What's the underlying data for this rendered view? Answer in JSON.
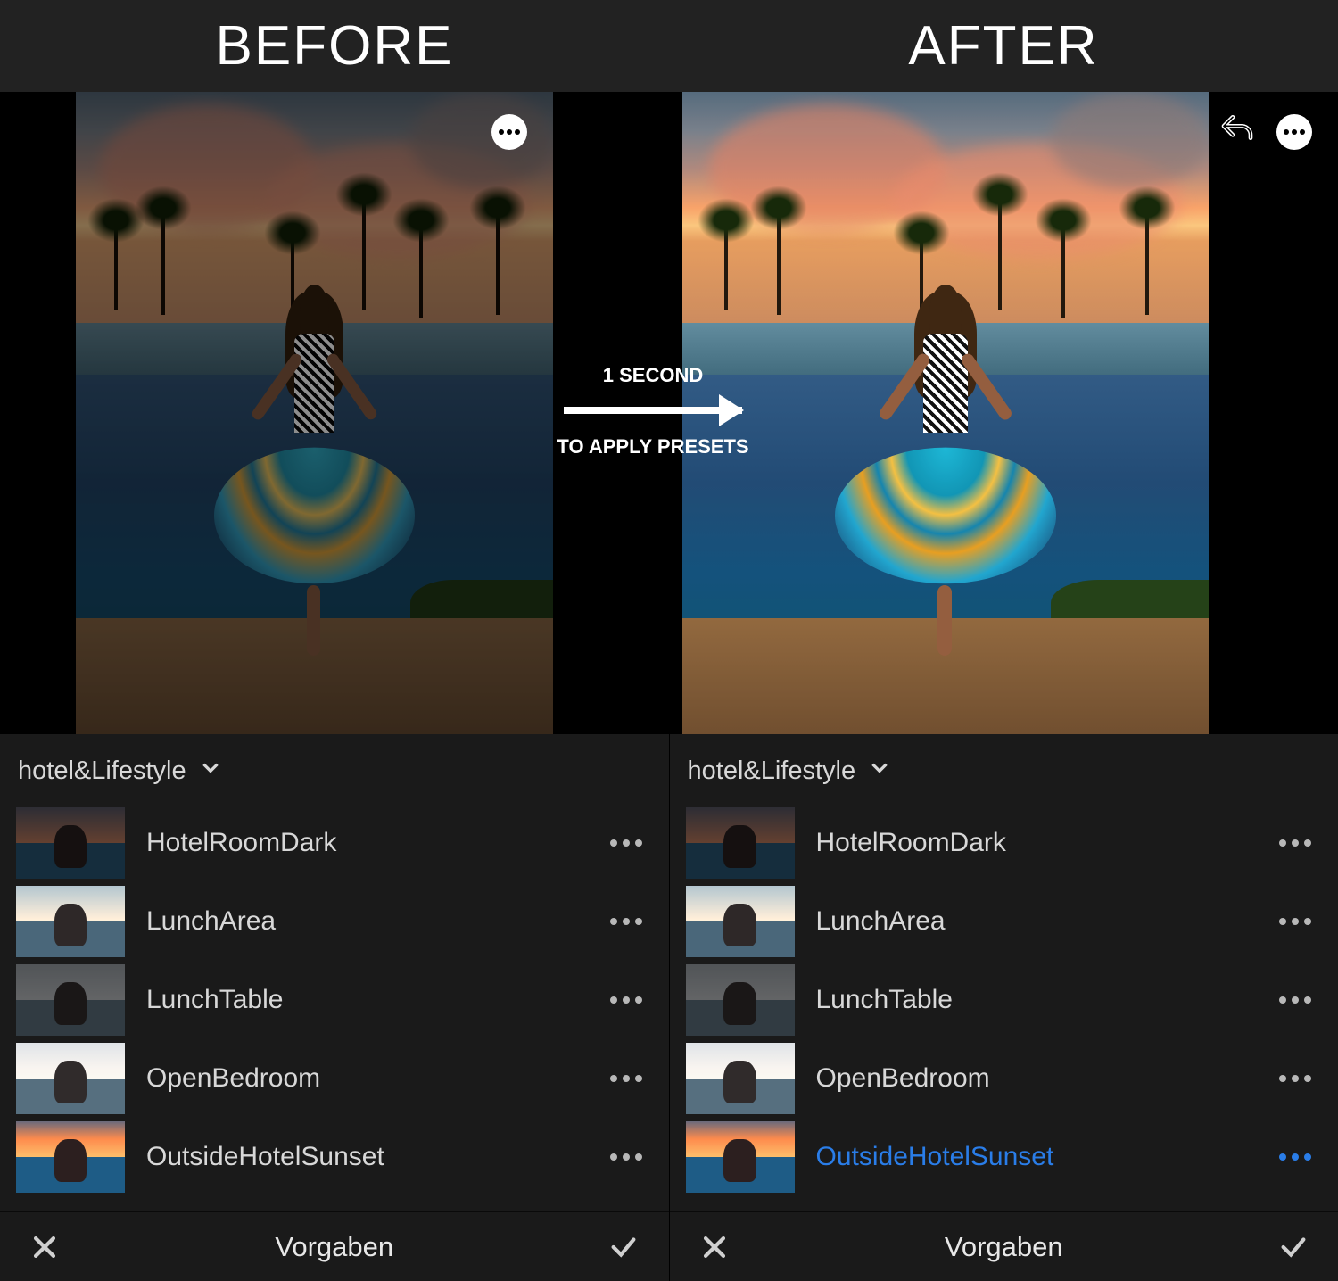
{
  "header": {
    "left": "BEFORE",
    "right": "AFTER"
  },
  "annotation": {
    "line1": "1 SECOND",
    "line2": "TO APPLY PRESETS"
  },
  "panels": {
    "left": {
      "group_name": "hotel&Lifestyle",
      "selected_index": null,
      "presets": [
        {
          "name": "HotelRoomDark"
        },
        {
          "name": "LunchArea"
        },
        {
          "name": "LunchTable"
        },
        {
          "name": "OpenBedroom"
        },
        {
          "name": "OutsideHotelSunset"
        }
      ],
      "bottom_bar_title": "Vorgaben"
    },
    "right": {
      "group_name": "hotel&Lifestyle",
      "selected_index": 4,
      "presets": [
        {
          "name": "HotelRoomDark"
        },
        {
          "name": "LunchArea"
        },
        {
          "name": "LunchTable"
        },
        {
          "name": "OpenBedroom"
        },
        {
          "name": "OutsideHotelSunset"
        }
      ],
      "bottom_bar_title": "Vorgaben"
    }
  }
}
